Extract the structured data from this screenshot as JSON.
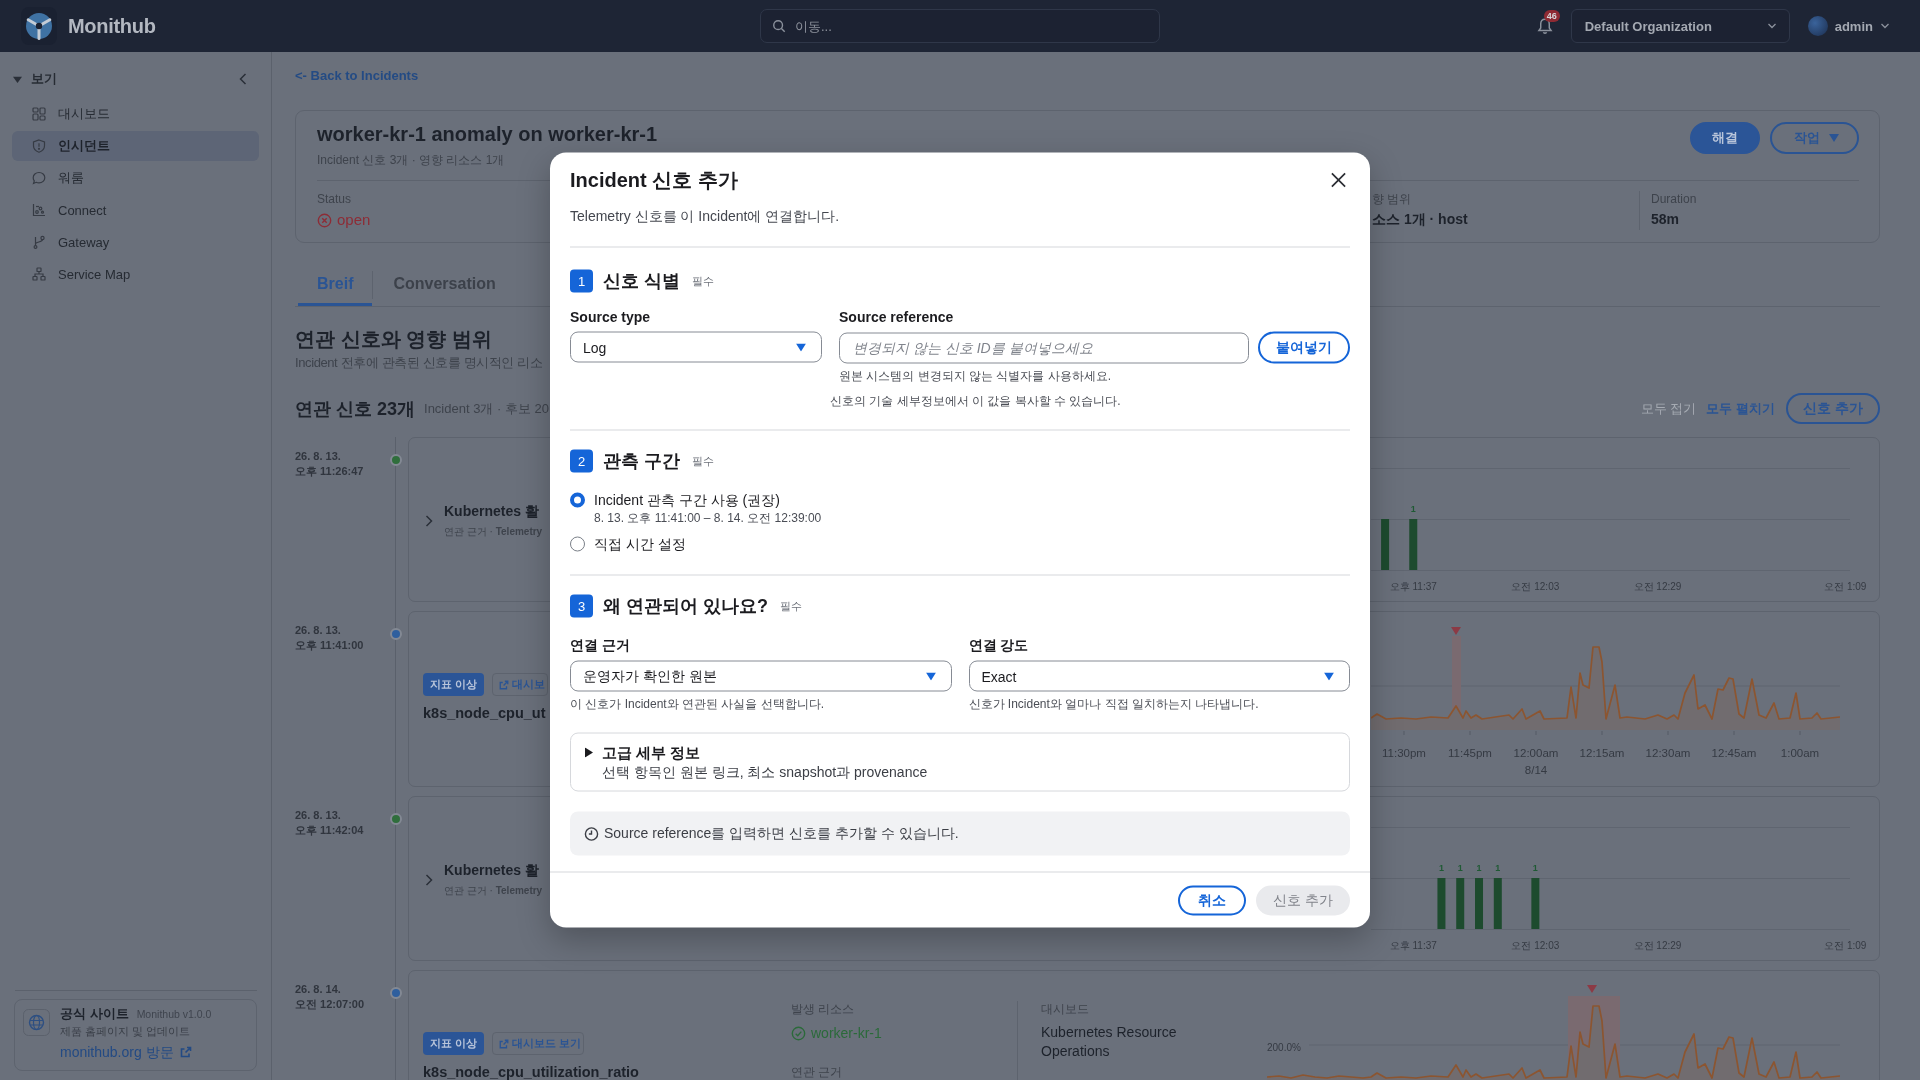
{
  "top_bar": {
    "app_name": "Monithub",
    "search": {
      "placeholder": "이동..."
    },
    "notification_count": "46",
    "organization": "Default Organization",
    "user": "admin"
  },
  "sidebar": {
    "section": {
      "label": "보기",
      "expanded": true
    },
    "items": [
      {
        "label": "대시보드",
        "selected": false
      },
      {
        "label": "인시던트",
        "selected": true
      },
      {
        "label": "워룸",
        "selected": false
      },
      {
        "label": "Connect",
        "selected": false
      },
      {
        "label": "Gateway",
        "selected": false
      },
      {
        "label": "Service Map",
        "selected": false
      }
    ],
    "footer": {
      "title": "공식 사이트",
      "version": "Monithub v1.0.0",
      "description": "제품 홈페이지 및 업데이트",
      "link": "monithub.org 방문"
    }
  },
  "back_link": "<- Back to Incidents",
  "incident": {
    "title": "worker-kr-1 anomaly on worker-kr-1",
    "subtitle": "Incident 신호 3개 · 영향 리소스 1개",
    "actions": [
      {
        "label": "해결",
        "kind": "primary"
      },
      {
        "label": "작업",
        "kind": "menu"
      }
    ],
    "stats": [
      {
        "label": "Status",
        "value": "open",
        "kind": "status"
      },
      {
        "label": "향 범위",
        "value": "소스 1개 · host",
        "kind": "text"
      },
      {
        "label": "Duration",
        "value": "58m",
        "kind": "text"
      }
    ]
  },
  "tabs": [
    {
      "label": "Breif",
      "selected": true
    },
    {
      "label": "Conversation",
      "selected": false
    }
  ],
  "related": {
    "title": "연관 신호와 영향 범위",
    "description": "Incident 전후에 관측된 신호를 명시적인 리소"
  },
  "signals": {
    "title": "연관 신호 23개",
    "summary": "Incident 3개 · 후보 20",
    "toggles": [
      {
        "label": "모두 접기",
        "disabled": true
      },
      {
        "label": "모두 펼치기",
        "disabled": false
      }
    ],
    "add_button": "신호 추가",
    "timeline": [
      {
        "date": "26. 8. 13.",
        "time": "오후 11:26:47",
        "color": "#2f6e3c",
        "kind": "activity",
        "title": "Kubernetes 활",
        "meta": "연관 근거 · **Telemetry**",
        "chart_data": {
          "type": "bar",
          "categories": [
            null,
            null,
            null,
            null,
            "오후 11:37",
            null,
            null,
            null,
            null,
            null,
            null,
            null,
            null,
            null,
            null,
            null,
            null,
            "오전 12:03",
            null,
            null,
            null,
            null,
            null,
            null,
            null,
            null,
            null,
            null,
            null,
            null,
            "오전 12:29",
            null,
            null,
            null,
            null,
            null,
            null,
            null,
            null,
            null,
            null,
            null,
            null,
            null,
            null,
            null,
            null,
            null,
            null,
            null,
            "오전 1:09"
          ],
          "values": [
            null,
            1,
            null,
            null,
            1,
            null,
            null,
            null,
            null,
            null,
            null,
            null,
            null,
            null,
            null,
            null,
            null,
            null,
            null,
            null,
            null,
            null,
            null,
            null,
            null,
            null,
            null,
            null,
            null,
            null,
            null,
            null,
            null,
            null,
            null,
            null,
            null,
            null,
            null,
            null,
            null,
            null,
            null,
            null,
            null,
            null,
            null,
            null,
            null,
            null,
            null
          ],
          "value_labels": [
            null,
            null,
            null,
            null,
            "1",
            null,
            null,
            null,
            null,
            null,
            null,
            null,
            null,
            null,
            null,
            null,
            null,
            null,
            null,
            null,
            null,
            null,
            null,
            null,
            null,
            null,
            null,
            null,
            null,
            null,
            null,
            null,
            null,
            null,
            null,
            null,
            null,
            null,
            null,
            null,
            null,
            null,
            null,
            null,
            null,
            null,
            null,
            null,
            null,
            null,
            null
          ]
        }
      },
      {
        "date": "26. 8. 13.",
        "time": "오후 11:41:00",
        "color": "#2f5f9e",
        "kind": "metric",
        "tags": [
          {
            "label": "지표 이상",
            "kind": "anomaly"
          },
          {
            "label": "대시보",
            "kind": "link"
          }
        ],
        "title": "k8s_node_cpu_ut",
        "chart": {
          "x_labels": [
            {
              "time": "11:30pm"
            },
            {
              "time": "11:45pm"
            },
            {
              "time": "12:00am",
              "date": "8/14"
            },
            {
              "time": "12:15am"
            },
            {
              "time": "12:30am"
            },
            {
              "time": "12:45am"
            },
            {
              "time": "1:00am"
            }
          ]
        }
      },
      {
        "date": "26. 8. 13.",
        "time": "오후 11:42:04",
        "color": "#2f6e3c",
        "kind": "activity",
        "title": "Kubernetes 활",
        "meta": "연관 근거 · **Telemetry**",
        "chart_data": {
          "type": "bar",
          "categories": [
            null,
            null,
            null,
            null,
            "오후 11:37",
            null,
            null,
            null,
            null,
            null,
            null,
            null,
            null,
            null,
            null,
            null,
            null,
            "오전 12:03",
            null,
            null,
            null,
            null,
            null,
            null,
            null,
            null,
            null,
            null,
            null,
            null,
            "오전 12:29",
            null,
            null,
            null,
            null,
            null,
            null,
            null,
            null,
            null,
            null,
            null,
            null,
            null,
            null,
            null,
            null,
            null,
            null,
            null,
            "오전 1:09"
          ],
          "values": [
            null,
            null,
            null,
            null,
            null,
            null,
            null,
            1,
            null,
            1,
            null,
            1,
            null,
            1,
            null,
            null,
            null,
            1,
            null,
            null,
            null,
            null,
            null,
            null,
            null,
            null,
            null,
            null,
            null,
            null,
            null,
            null,
            null,
            null,
            null,
            null,
            null,
            null,
            null,
            null,
            null,
            null,
            null,
            null,
            null,
            null,
            null,
            null,
            null,
            null,
            null
          ],
          "value_labels": [
            null,
            null,
            null,
            null,
            null,
            null,
            null,
            "1",
            null,
            "1",
            null,
            "1",
            null,
            "1",
            null,
            null,
            null,
            "1",
            null,
            null,
            null,
            null,
            null,
            null,
            null,
            null,
            null,
            null,
            null,
            null,
            null,
            null,
            null,
            null,
            null,
            null,
            null,
            null,
            null,
            null,
            null,
            null,
            null,
            null,
            null,
            null,
            null,
            null,
            null,
            null,
            null
          ]
        }
      },
      {
        "date": "26. 8. 14.",
        "time": "오전 12:07:00",
        "color": "#2f5f9e",
        "kind": "metric",
        "tags": [
          {
            "label": "지표 이상",
            "kind": "anomaly"
          },
          {
            "label": "대시보드 보기",
            "kind": "link"
          }
        ],
        "title": "k8s_node_cpu_utilization_ratio",
        "resource": {
          "label": "발생 리소스",
          "value": "worker-kr-1"
        },
        "evidence_label": "연관 근거",
        "dashboard": {
          "label": "대시보드",
          "value": "Kubernetes Resource Operations"
        },
        "chart": {
          "y_label": "200.0%"
        }
      }
    ]
  },
  "modal": {
    "title": "Incident 신호 추가",
    "subtitle": "Telemetry 신호를 이 Incident에 연결합니다.",
    "sections": [
      {
        "number": "1",
        "title": "신호 식별",
        "required": "필수",
        "kind": "identify",
        "source_type": {
          "label": "Source type",
          "value": "Log"
        },
        "source_reference": {
          "label": "Source reference",
          "placeholder": "변경되지 않는 신호 ID를 붙여넣으세요",
          "button": "붙여넣기",
          "hint": "원본 시스템의 변경되지 않는 식별자를 사용하세요."
        },
        "note": "신호의 기술 세부정보에서 이 값을 복사할 수 있습니다."
      },
      {
        "number": "2",
        "title": "관측 구간",
        "required": "필수",
        "kind": "window",
        "options": [
          {
            "label": "Incident 관측 구간 사용 (권장)",
            "detail": "8. 13. 오후 11:41:00 – 8. 14. 오전 12:39:00",
            "selected": true
          },
          {
            "label": "직접 시간 설정",
            "selected": false
          }
        ]
      },
      {
        "number": "3",
        "title": "왜 연관되어 있나요?",
        "required": "필수",
        "kind": "relation",
        "fields": [
          {
            "label": "연결 근거",
            "value": "운영자가 확인한 원본",
            "hint": "이 신호가 Incident와 연관된 사실을 선택합니다."
          },
          {
            "label": "연결 강도",
            "value": "Exact",
            "hint": "신호가 Incident와 얼마나 직접 일치하는지 나타냅니다."
          }
        ]
      }
    ],
    "advanced": {
      "title": "고급 세부 정보",
      "description": "선택 항목인 원본 링크, 최소 snapshot과 provenance",
      "expanded": false
    },
    "info": "Source reference를 입력하면 신호를 추가할 수 있습니다.",
    "buttons": [
      {
        "label": "취소",
        "kind": "secondary",
        "disabled": false
      },
      {
        "label": "신호 추가",
        "kind": "primary",
        "disabled": true
      }
    ]
  }
}
